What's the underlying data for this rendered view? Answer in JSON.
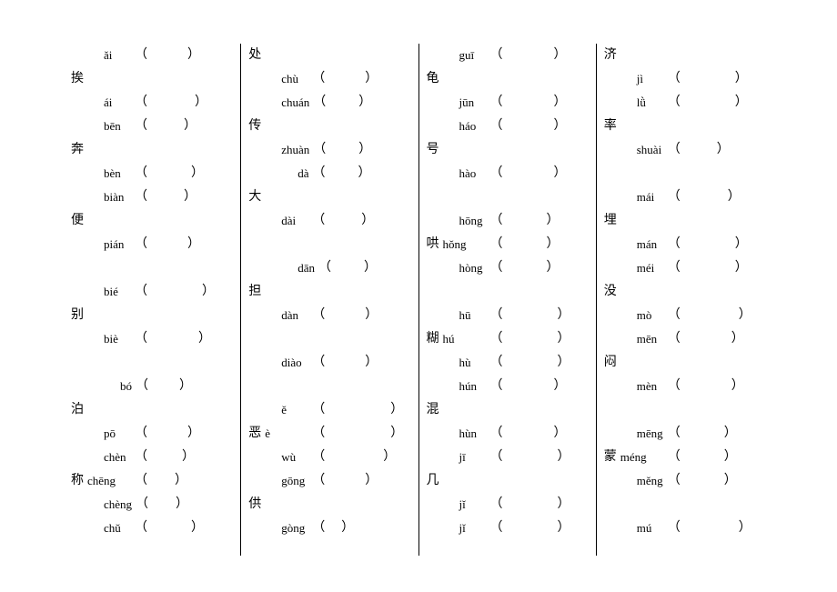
{
  "columns": [
    {
      "rows": [
        {
          "hanzi": "",
          "pinyin": "ǎi",
          "indent": 1,
          "gap": 44
        },
        {
          "hanzi": "挨",
          "pinyin": "",
          "indent": 0,
          "gap": 0
        },
        {
          "hanzi": "",
          "pinyin": "ái",
          "indent": 1,
          "gap": 52
        },
        {
          "hanzi": "",
          "pinyin": "bēn",
          "indent": 1,
          "gap": 40
        },
        {
          "hanzi": "奔",
          "pinyin": "",
          "indent": 0,
          "gap": 0
        },
        {
          "hanzi": "",
          "pinyin": "bèn",
          "indent": 1,
          "gap": 48
        },
        {
          "hanzi": "",
          "pinyin": "biàn",
          "indent": 1,
          "gap": 40
        },
        {
          "hanzi": "便",
          "pinyin": "",
          "indent": 0,
          "gap": 0
        },
        {
          "hanzi": "",
          "pinyin": "pián",
          "indent": 1,
          "gap": 44
        },
        {
          "hanzi": "",
          "pinyin": "",
          "indent": 0,
          "gap": 0,
          "blank": true
        },
        {
          "hanzi": "",
          "pinyin": "bié",
          "indent": 1,
          "gap": 60
        },
        {
          "hanzi": "别",
          "pinyin": "",
          "indent": 0,
          "gap": 0
        },
        {
          "hanzi": "",
          "pinyin": "biè",
          "indent": 1,
          "gap": 56
        },
        {
          "hanzi": "",
          "pinyin": "",
          "indent": 0,
          "gap": 0,
          "blank": true
        },
        {
          "hanzi": "",
          "pinyin": "bó",
          "indent": 2,
          "gap": 34
        },
        {
          "hanzi": "泊",
          "pinyin": "",
          "indent": 0,
          "gap": 0
        },
        {
          "hanzi": "",
          "pinyin": "pō",
          "indent": 1,
          "gap": 44
        },
        {
          "hanzi": "",
          "pinyin": "chèn",
          "indent": 1,
          "gap": 38
        },
        {
          "hanzi": "称",
          "pinyin": "chēng",
          "indent": 0,
          "gap": 30
        },
        {
          "hanzi": "",
          "pinyin": "chèng",
          "indent": 1,
          "gap": 30
        },
        {
          "hanzi": "",
          "pinyin": "chǔ",
          "indent": 1,
          "gap": 48
        }
      ]
    },
    {
      "rows": [
        {
          "hanzi": "处",
          "pinyin": "",
          "indent": 0,
          "gap": 0
        },
        {
          "hanzi": "",
          "pinyin": "chù",
          "indent": 1,
          "gap": 44
        },
        {
          "hanzi": "",
          "pinyin": "chuán",
          "indent": 1,
          "gap": 36
        },
        {
          "hanzi": "传",
          "pinyin": "",
          "indent": 0,
          "gap": 0
        },
        {
          "hanzi": "",
          "pinyin": "zhuàn",
          "indent": 1,
          "gap": 36
        },
        {
          "hanzi": "",
          "pinyin": "dà",
          "indent": 2,
          "gap": 36
        },
        {
          "hanzi": "大",
          "pinyin": "",
          "indent": 0,
          "gap": 0
        },
        {
          "hanzi": "",
          "pinyin": "dài",
          "indent": 1,
          "gap": 40
        },
        {
          "hanzi": "",
          "pinyin": "",
          "indent": 0,
          "gap": 0,
          "blank": true
        },
        {
          "hanzi": "",
          "pinyin": "dān",
          "indent": 2,
          "gap": 36
        },
        {
          "hanzi": "担",
          "pinyin": "",
          "indent": 0,
          "gap": 0
        },
        {
          "hanzi": "",
          "pinyin": "dàn",
          "indent": 1,
          "gap": 44
        },
        {
          "hanzi": "",
          "pinyin": "",
          "indent": 0,
          "gap": 0,
          "blank": true
        },
        {
          "hanzi": "",
          "pinyin": "diào",
          "indent": 1,
          "gap": 44
        },
        {
          "hanzi": "",
          "pinyin": "",
          "indent": 0,
          "gap": 0,
          "blank": true
        },
        {
          "hanzi": "",
          "pinyin": "ě",
          "indent": 1,
          "gap": 72
        },
        {
          "hanzi": "恶",
          "pinyin": "è",
          "indent": 0,
          "gap": 72
        },
        {
          "hanzi": "",
          "pinyin": "wù",
          "indent": 1,
          "gap": 64
        },
        {
          "hanzi": "",
          "pinyin": "gōng",
          "indent": 1,
          "gap": 44
        },
        {
          "hanzi": "供",
          "pinyin": "",
          "indent": 0,
          "gap": 0
        },
        {
          "hanzi": "",
          "pinyin": "gòng",
          "indent": 1,
          "gap": 18
        }
      ]
    },
    {
      "rows": [
        {
          "hanzi": "",
          "pinyin": "guī",
          "indent": 1,
          "gap": 56
        },
        {
          "hanzi": "龟",
          "pinyin": "",
          "indent": 0,
          "gap": 0
        },
        {
          "hanzi": "",
          "pinyin": "jūn",
          "indent": 1,
          "gap": 56
        },
        {
          "hanzi": "",
          "pinyin": "háo",
          "indent": 1,
          "gap": 56
        },
        {
          "hanzi": "号",
          "pinyin": "",
          "indent": 0,
          "gap": 0
        },
        {
          "hanzi": "",
          "pinyin": "hào",
          "indent": 1,
          "gap": 56
        },
        {
          "hanzi": "",
          "pinyin": "",
          "indent": 0,
          "gap": 0,
          "blank": true
        },
        {
          "hanzi": "",
          "pinyin": "hōng",
          "indent": 1,
          "gap": 48
        },
        {
          "hanzi": "哄",
          "pinyin": "hǒng",
          "indent": 0,
          "gap": 48
        },
        {
          "hanzi": "",
          "pinyin": "hòng",
          "indent": 1,
          "gap": 48
        },
        {
          "hanzi": "",
          "pinyin": "",
          "indent": 0,
          "gap": 0,
          "blank": true
        },
        {
          "hanzi": "",
          "pinyin": "hū",
          "indent": 1,
          "gap": 60
        },
        {
          "hanzi": "糊",
          "pinyin": "hú",
          "indent": 0,
          "gap": 60
        },
        {
          "hanzi": "",
          "pinyin": "hù",
          "indent": 1,
          "gap": 60
        },
        {
          "hanzi": "",
          "pinyin": "hún",
          "indent": 1,
          "gap": 56
        },
        {
          "hanzi": "混",
          "pinyin": "",
          "indent": 0,
          "gap": 0
        },
        {
          "hanzi": "",
          "pinyin": "hùn",
          "indent": 1,
          "gap": 56
        },
        {
          "hanzi": "",
          "pinyin": "jī",
          "indent": 1,
          "gap": 60
        },
        {
          "hanzi": "几",
          "pinyin": "",
          "indent": 0,
          "gap": 0
        },
        {
          "hanzi": "",
          "pinyin": "jǐ",
          "indent": 1,
          "gap": 60
        },
        {
          "hanzi": "",
          "pinyin": "jǐ",
          "indent": 1,
          "gap": 60
        }
      ]
    },
    {
      "rows": [
        {
          "hanzi": "济",
          "pinyin": "",
          "indent": 0,
          "gap": 0
        },
        {
          "hanzi": "",
          "pinyin": "jì",
          "indent": 1,
          "gap": 60
        },
        {
          "hanzi": "",
          "pinyin": "lǜ",
          "indent": 1,
          "gap": 60
        },
        {
          "hanzi": "率",
          "pinyin": "",
          "indent": 0,
          "gap": 0
        },
        {
          "hanzi": "",
          "pinyin": "shuài",
          "indent": 1,
          "gap": 40
        },
        {
          "hanzi": "",
          "pinyin": "",
          "indent": 0,
          "gap": 0,
          "blank": true
        },
        {
          "hanzi": "",
          "pinyin": "mái",
          "indent": 1,
          "gap": 52
        },
        {
          "hanzi": "埋",
          "pinyin": "",
          "indent": 0,
          "gap": 0
        },
        {
          "hanzi": "",
          "pinyin": "mán",
          "indent": 1,
          "gap": 60
        },
        {
          "hanzi": "",
          "pinyin": "méi",
          "indent": 1,
          "gap": 60
        },
        {
          "hanzi": "没",
          "pinyin": "",
          "indent": 0,
          "gap": 0
        },
        {
          "hanzi": "",
          "pinyin": "mò",
          "indent": 1,
          "gap": 64
        },
        {
          "hanzi": "",
          "pinyin": "mēn",
          "indent": 1,
          "gap": 56
        },
        {
          "hanzi": "闷",
          "pinyin": "",
          "indent": 0,
          "gap": 0
        },
        {
          "hanzi": "",
          "pinyin": "mèn",
          "indent": 1,
          "gap": 56
        },
        {
          "hanzi": "",
          "pinyin": "",
          "indent": 0,
          "gap": 0,
          "blank": true
        },
        {
          "hanzi": "",
          "pinyin": "mēng",
          "indent": 1,
          "gap": 48
        },
        {
          "hanzi": "蒙",
          "pinyin": "méng",
          "indent": 0,
          "gap": 48
        },
        {
          "hanzi": "",
          "pinyin": "měng",
          "indent": 1,
          "gap": 48
        },
        {
          "hanzi": "",
          "pinyin": "",
          "indent": 0,
          "gap": 0,
          "blank": true
        },
        {
          "hanzi": "",
          "pinyin": "mú",
          "indent": 1,
          "gap": 64
        }
      ]
    }
  ]
}
